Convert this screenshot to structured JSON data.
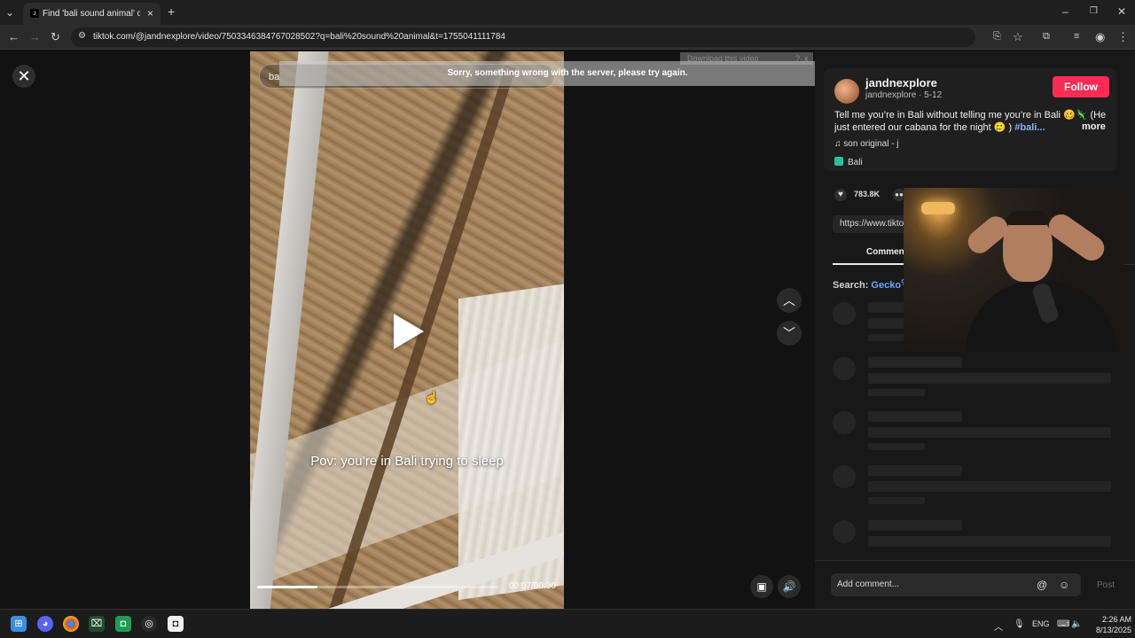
{
  "browser": {
    "tab_title": "Find 'bali sound animal' on TikTok",
    "tab_favicon": "tiktok-icon",
    "url": "tiktok.com/@jandnexplore/video/7503346384767028502?q=bali%20sound%20animal&t=1755041111784"
  },
  "overlays": {
    "error_toast": "Sorry, something wrong with the server, please try again.",
    "download_banner": "Download this video",
    "download_help": "?",
    "download_close": "x"
  },
  "video": {
    "search_text": "ba",
    "caption": "Pov: you’re in Bali trying to sleep",
    "timecode": "00:07/00:30",
    "progress": 0.25
  },
  "panel": {
    "author_name": "jandnexplore",
    "author_sub": "jandnexplore · 5-12",
    "follow_label": "Follow",
    "description": "Tell me you’re in Bali without telling me you’re in Bali 🥴🦎 (He just entered our cabana for the night 🥲 )",
    "hashtag": "#bali...",
    "more_label": "more",
    "music": "♫  son original - j",
    "location": "Bali",
    "likes": "783.8K",
    "link": "https://www.tikto",
    "comments_tab": "Comment",
    "search_prefix": "Search:",
    "search_term": "Gecko",
    "comment_placeholder": "Add comment...",
    "post_label": "Post"
  },
  "taskbar": {
    "lang": "ENG",
    "time": "2:26 AM",
    "date": "8/13/2025"
  },
  "colors": {
    "accent": "#fe2c55",
    "hashtag": "#8ab4f8",
    "search_term": "#6ba6ff"
  }
}
